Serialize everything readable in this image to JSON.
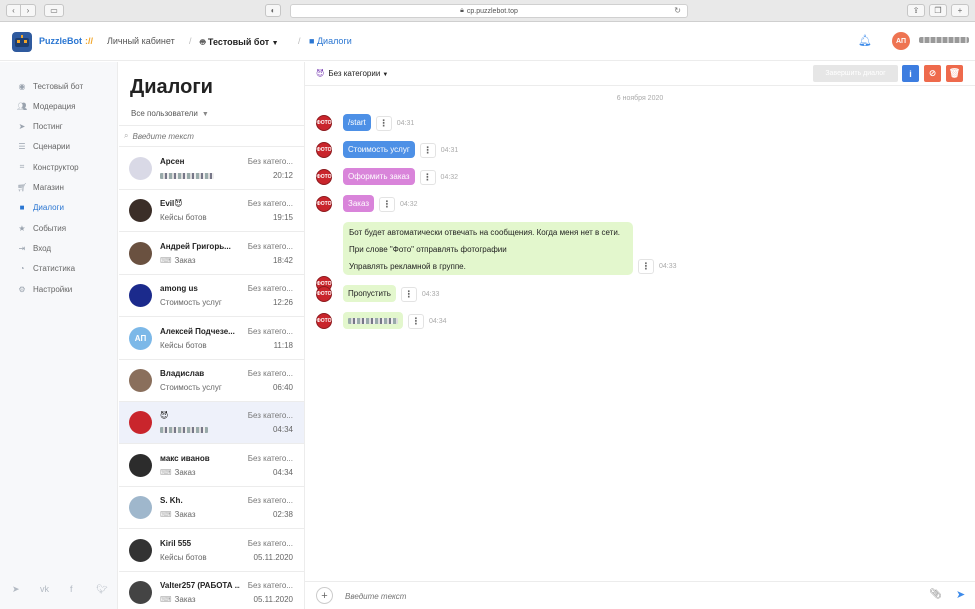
{
  "browser": {
    "url": "cp.puzzlebot.top"
  },
  "header": {
    "brand": "PuzzleBot",
    "brand_slashes": "://",
    "crumb_cabinet": "Личный кабинет",
    "crumb_bot": "Тестовый бот",
    "crumb_page": "Диалоги",
    "user_initials": "АП"
  },
  "sidebar": {
    "items": [
      {
        "label": "Тестовый бот",
        "icon": "robot-icon"
      },
      {
        "label": "Модерация",
        "icon": "users-icon"
      },
      {
        "label": "Постинг",
        "icon": "send-icon"
      },
      {
        "label": "Сценарии",
        "icon": "database-icon"
      },
      {
        "label": "Конструктор",
        "icon": "sitemap-icon"
      },
      {
        "label": "Магазин",
        "icon": "cart-icon"
      },
      {
        "label": "Диалоги",
        "icon": "chat-icon"
      },
      {
        "label": "События",
        "icon": "star-icon"
      },
      {
        "label": "Вход",
        "icon": "sign-in-icon"
      },
      {
        "label": "Статистика",
        "icon": "pie-chart-icon"
      },
      {
        "label": "Настройки",
        "icon": "gear-icon"
      }
    ],
    "active_index": 6
  },
  "dialogs": {
    "title": "Диалоги",
    "filter": "Все пользователи",
    "search_placeholder": "Введите текст",
    "items": [
      {
        "name": "Арсен",
        "category": "Без катего...",
        "message": "",
        "time": "20:12",
        "avatar_color": "#d9d9e6"
      },
      {
        "name": "Evil😈",
        "category": "Без катего...",
        "message": "Кейсы ботов",
        "time": "19:15",
        "avatar_color": "#3b2e28"
      },
      {
        "name": "Андрей Григорь...",
        "category": "Без катего...",
        "message": "Заказ",
        "time": "18:42",
        "avatar_color": "#6a5140"
      },
      {
        "name": "among us",
        "category": "Без катего...",
        "message": "Стоимость услуг",
        "time": "12:26",
        "avatar_color": "#1b2a8c"
      },
      {
        "name": "Алексей Подчезе...",
        "category": "Без катего...",
        "message": "Кейсы ботов",
        "time": "11:18",
        "avatar_color": "#7cb8e8",
        "initials": "АП"
      },
      {
        "name": "Владислав",
        "category": "Без катего...",
        "message": "Стоимость услуг",
        "time": "06:40",
        "avatar_color": "#8a6f5c"
      },
      {
        "name": "😈",
        "category": "Без катего...",
        "message": "",
        "time": "04:34",
        "avatar_color": "#c9252c"
      },
      {
        "name": "макс иванов",
        "category": "Без катего...",
        "message": "Заказ",
        "time": "04:34",
        "avatar_color": "#2c2c2c"
      },
      {
        "name": "S. Kh.",
        "category": "Без катего...",
        "message": "Заказ",
        "time": "02:38",
        "avatar_color": "#9fb7cc"
      },
      {
        "name": "Kiril 555",
        "category": "Без катего...",
        "message": "Кейсы ботов",
        "time": "05.11.2020",
        "avatar_color": "#333333"
      },
      {
        "name": "Valter257 (РАБОТА ...",
        "category": "Без катего...",
        "message": "Заказ",
        "time": "05.11.2020",
        "avatar_color": "#444444"
      }
    ]
  },
  "chat": {
    "category": "Без категории",
    "end_button": "Завершить диалог",
    "date": "6 ноября 2020",
    "messages": [
      {
        "text": "/start",
        "time": "04:31"
      },
      {
        "text": "Стоимость услуг",
        "time": "04:31"
      },
      {
        "text": "Оформить заказ",
        "time": "04:32"
      },
      {
        "text": "Заказ",
        "time": "04:32"
      },
      {
        "lines": [
          "Бот будет автоматически отвечать на сообщения. Когда меня нет в сети.",
          "При слове \"Фото\" отправлять фотографии",
          "Управлять рекламной в группе."
        ],
        "time": "04:33"
      },
      {
        "text": "Пропустить",
        "time": "04:33"
      },
      {
        "text": "",
        "time": "04:34"
      }
    ],
    "input_placeholder": "Введите текст"
  },
  "colors": {
    "accent": "#2a76d2",
    "info_button": "#3d7de0",
    "block_button": "#ee6a4c",
    "delete_button": "#ee6a4c"
  }
}
